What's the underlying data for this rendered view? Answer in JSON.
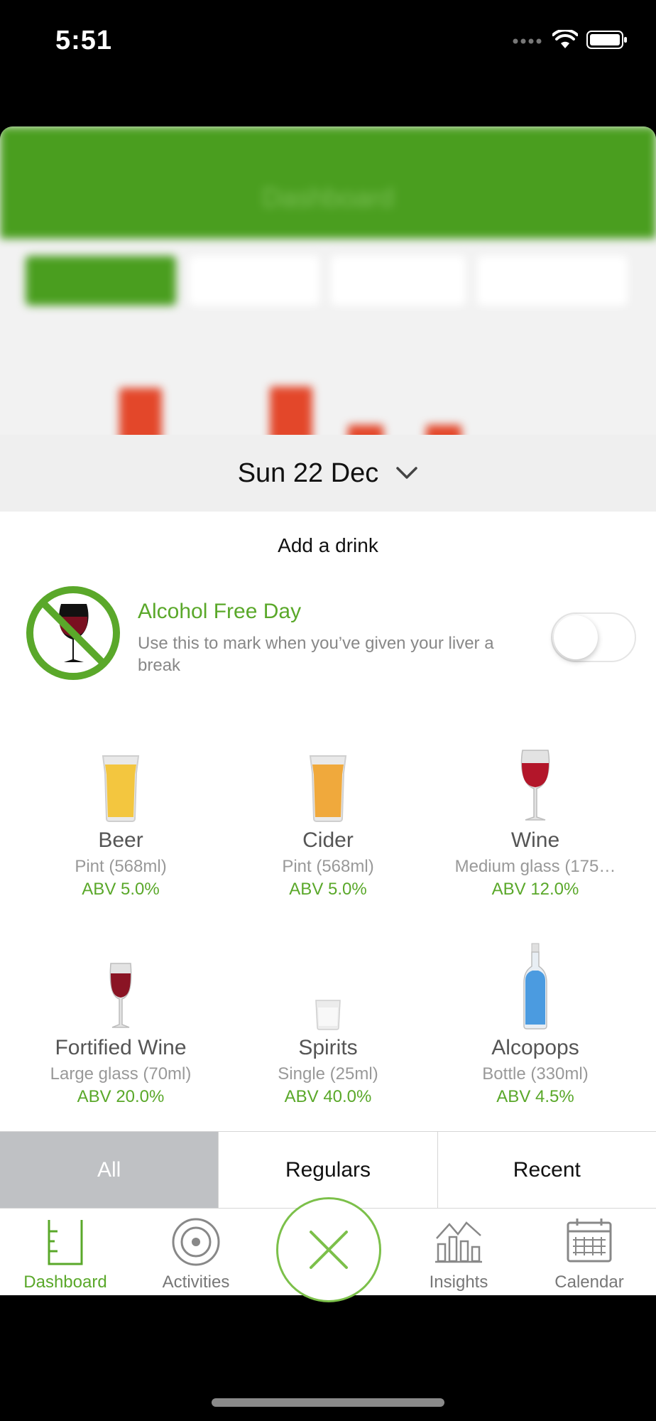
{
  "status": {
    "time": "5:51"
  },
  "background": {
    "header_title": "Dashboard"
  },
  "sheet": {
    "date": "Sun 22 Dec",
    "title": "Add a drink",
    "alcohol_free": {
      "title": "Alcohol Free Day",
      "description": "Use this to mark when you’ve given your liver a break",
      "enabled": false
    },
    "drinks": [
      {
        "name": "Beer",
        "size": "Pint (568ml)",
        "abv": "ABV 5.0%",
        "icon": "beer-pint-icon"
      },
      {
        "name": "Cider",
        "size": "Pint (568ml)",
        "abv": "ABV 5.0%",
        "icon": "cider-pint-icon"
      },
      {
        "name": "Wine",
        "size": "Medium glass (175…",
        "abv": "ABV 12.0%",
        "icon": "wine-glass-icon"
      },
      {
        "name": "Fortified Wine",
        "size": "Large glass (70ml)",
        "abv": "ABV 20.0%",
        "icon": "fortified-wine-glass-icon"
      },
      {
        "name": "Spirits",
        "size": "Single (25ml)",
        "abv": "ABV 40.0%",
        "icon": "spirits-glass-icon"
      },
      {
        "name": "Alcopops",
        "size": "Bottle (330ml)",
        "abv": "ABV 4.5%",
        "icon": "alcopop-bottle-icon"
      }
    ],
    "tabs": [
      {
        "label": "All",
        "active": true
      },
      {
        "label": "Regulars",
        "active": false
      },
      {
        "label": "Recent",
        "active": false
      }
    ]
  },
  "nav": {
    "items": [
      {
        "label": "Dashboard",
        "icon": "measuring-jug-icon",
        "active": true
      },
      {
        "label": "Activities",
        "icon": "target-icon",
        "active": false
      },
      {
        "label": "Insights",
        "icon": "chart-icon",
        "active": false
      },
      {
        "label": "Calendar",
        "icon": "calendar-icon",
        "active": false
      }
    ],
    "center_button_icon": "close-icon"
  },
  "colors": {
    "accent": "#5aa82a",
    "header_green": "#4a9e1f",
    "wine_red": "#b3162a",
    "beer_yellow": "#f3c63f",
    "cider_orange": "#f0a93c",
    "alcopop_blue": "#4b9be0"
  }
}
